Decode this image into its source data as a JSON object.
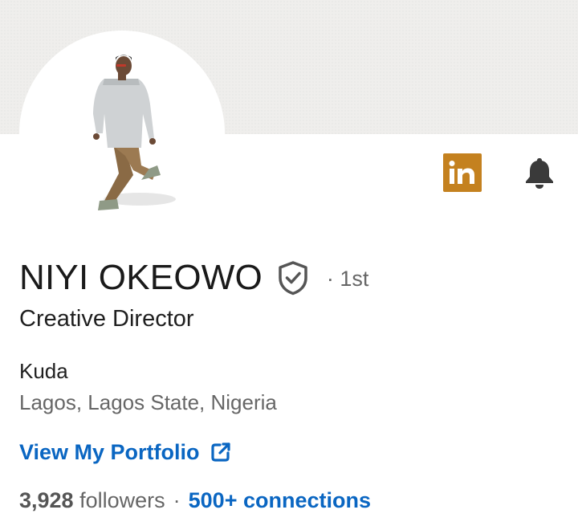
{
  "profile": {
    "name": "NIYI OKEOWO",
    "degree": "· 1st",
    "headline": "Creative Director",
    "company": "Kuda",
    "location": "Lagos, Lagos State, Nigeria",
    "portfolio_label": "View My Portfolio",
    "followers_count": "3,928",
    "followers_label": "followers",
    "separator": "·",
    "connections_label": "500+ connections"
  },
  "icons": {
    "verified": "shield-check-icon",
    "linkedin": "linkedin-icon",
    "notify": "bell-icon",
    "external": "external-link-icon"
  },
  "colors": {
    "link": "#0a66c2",
    "linkedin_badge": "#c4811f",
    "banner": "#efeeec",
    "muted_text": "#666666"
  },
  "badge_text": "in"
}
